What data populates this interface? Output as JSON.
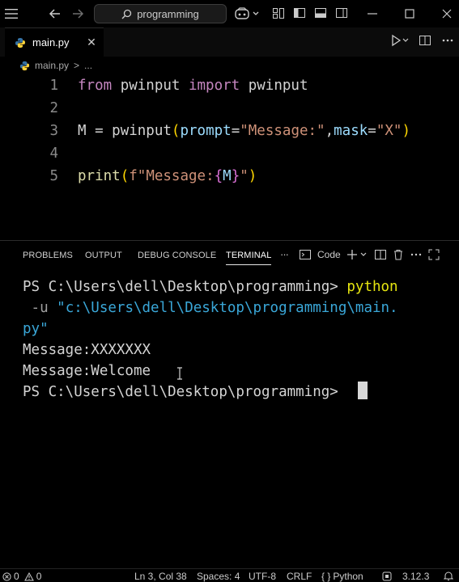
{
  "titlebar": {
    "search_text": "programming",
    "icons": [
      "menu-icon",
      "back-arrow-icon",
      "forward-arrow-icon",
      "search-icon",
      "copilot-icon",
      "chevron-down-icon",
      "customize-layout-icon",
      "toggle-sidebar-icon",
      "toggle-panel-icon",
      "toggle-secondary-sidebar-icon",
      "minimize-icon",
      "maximize-icon",
      "close-icon"
    ]
  },
  "tab": {
    "label": "main.py"
  },
  "breadcrumb": {
    "file": "main.py",
    "sep": ">",
    "more": "..."
  },
  "editor": {
    "line_numbers": [
      "1",
      "2",
      "3",
      "4",
      "5"
    ],
    "lines": {
      "l1": {
        "from": "from",
        "mod": " pwinput ",
        "import": "import",
        "name": " pwinput"
      },
      "l3": {
        "var": "M",
        "eq": " = ",
        "fn": "pwinput",
        "open": "(",
        "p1": "prompt",
        "eq1": "=",
        "s1": "\"Message:\"",
        "comma": ",",
        "p2": "mask",
        "eq2": "=",
        "s2": "\"X\"",
        "close": ")"
      },
      "l5": {
        "fn": "print",
        "open": "(",
        "f": "f",
        "s_a": "\"Message:",
        "b_open": "{",
        "v": "M",
        "b_close": "}",
        "s_b": "\"",
        "close": ")"
      }
    }
  },
  "panel": {
    "tabs": [
      "PROBLEMS",
      "OUTPUT",
      "DEBUG CONSOLE",
      "TERMINAL"
    ],
    "active_tab": "TERMINAL",
    "more": "···",
    "terminal_profile": "Code",
    "terminal": {
      "prompt1": "PS C:\\Users\\dell\\Desktop\\programming> ",
      "cmd": "python",
      "flag": " -u ",
      "path_a": "\"c:\\Users\\dell\\Desktop\\programming\\main.",
      "path_b": "py\"",
      "out1": "Message:XXXXXXX",
      "out2": "Message:Welcome",
      "prompt2": "PS C:\\Users\\dell\\Desktop\\programming> "
    }
  },
  "statusbar": {
    "errors": "0",
    "warnings": "0",
    "position": "Ln 3, Col 38",
    "spaces": "Spaces: 4",
    "encoding": "UTF-8",
    "eol": "CRLF",
    "language": "Python",
    "python_version": "3.12.3"
  },
  "colors": {
    "background": "#000000",
    "python_blue": "#3572A5",
    "python_yellow": "#FFD43B",
    "terminal_yellow": "#e5e510",
    "terminal_cyan": "#3aa7d8"
  }
}
